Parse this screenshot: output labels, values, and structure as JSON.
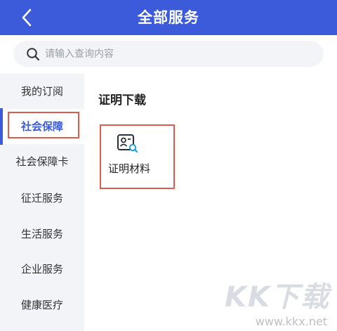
{
  "header": {
    "title": "全部服务",
    "back_icon": "chevron-left-icon"
  },
  "search": {
    "placeholder": "请输入查询内容",
    "value": "",
    "icon": "search-icon"
  },
  "sidebar": {
    "active_index": 1,
    "items": [
      {
        "label": "我的订阅"
      },
      {
        "label": "社会保障"
      },
      {
        "label": "社会保障卡"
      },
      {
        "label": "征迁服务"
      },
      {
        "label": "生活服务"
      },
      {
        "label": "企业服务"
      },
      {
        "label": "健康医疗"
      }
    ]
  },
  "main": {
    "section_title": "证明下载",
    "items": [
      {
        "label": "证明材料",
        "icon": "certificate-search-icon"
      }
    ]
  },
  "watermark": {
    "logo": "KK下载",
    "url": "www.kkx.net"
  },
  "colors": {
    "brand": "#3b5bdb",
    "highlight_outline": "#e05a4f",
    "sidebar_bg": "#f3f4f7",
    "search_bg": "#f2f4f7"
  }
}
